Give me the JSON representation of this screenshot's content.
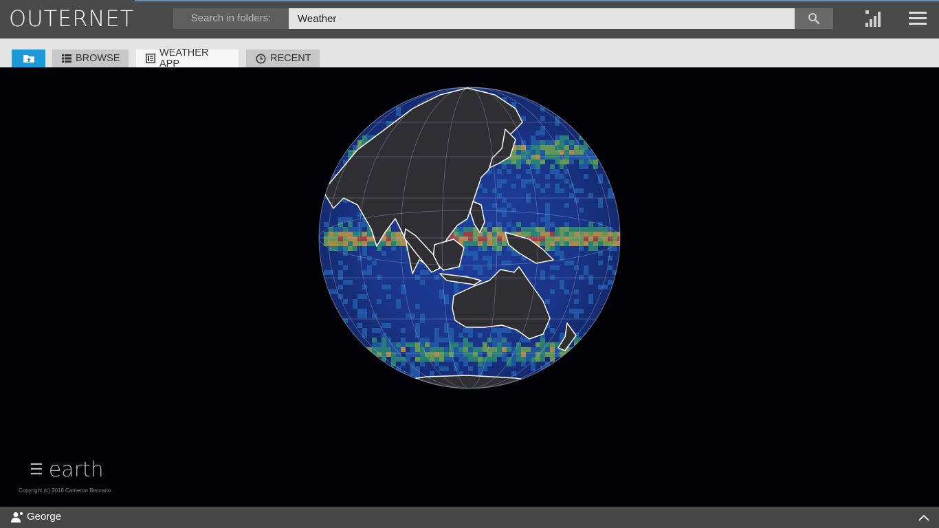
{
  "app": {
    "logo": "OUTERNET"
  },
  "search": {
    "label": "Search in folders:",
    "value": "Weather",
    "icon": "search-icon"
  },
  "header": {
    "stats_icon": "signal-bars-icon",
    "menu_icon": "hamburger-menu-icon"
  },
  "tabs": [
    {
      "id": "home",
      "label": "",
      "icon": "folder-up-icon",
      "active": false
    },
    {
      "id": "browse",
      "label": "BROWSE",
      "icon": "list-icon",
      "active": false
    },
    {
      "id": "weather",
      "label": "WEATHER APP",
      "icon": "app-window-icon",
      "active": true
    },
    {
      "id": "recent",
      "label": "RECENT",
      "icon": "clock-icon",
      "active": false
    }
  ],
  "earth": {
    "menu_label": "earth",
    "copyright": "Copyright (c) 2016 Cameron Beccario"
  },
  "footer": {
    "user": "George"
  },
  "colors": {
    "header_bg": "#4a4a4a",
    "tab_bar_bg": "#e4e4e4",
    "home_tab": "#1a9ad6",
    "footer_bg": "#474747",
    "map_bg": "#020206"
  }
}
